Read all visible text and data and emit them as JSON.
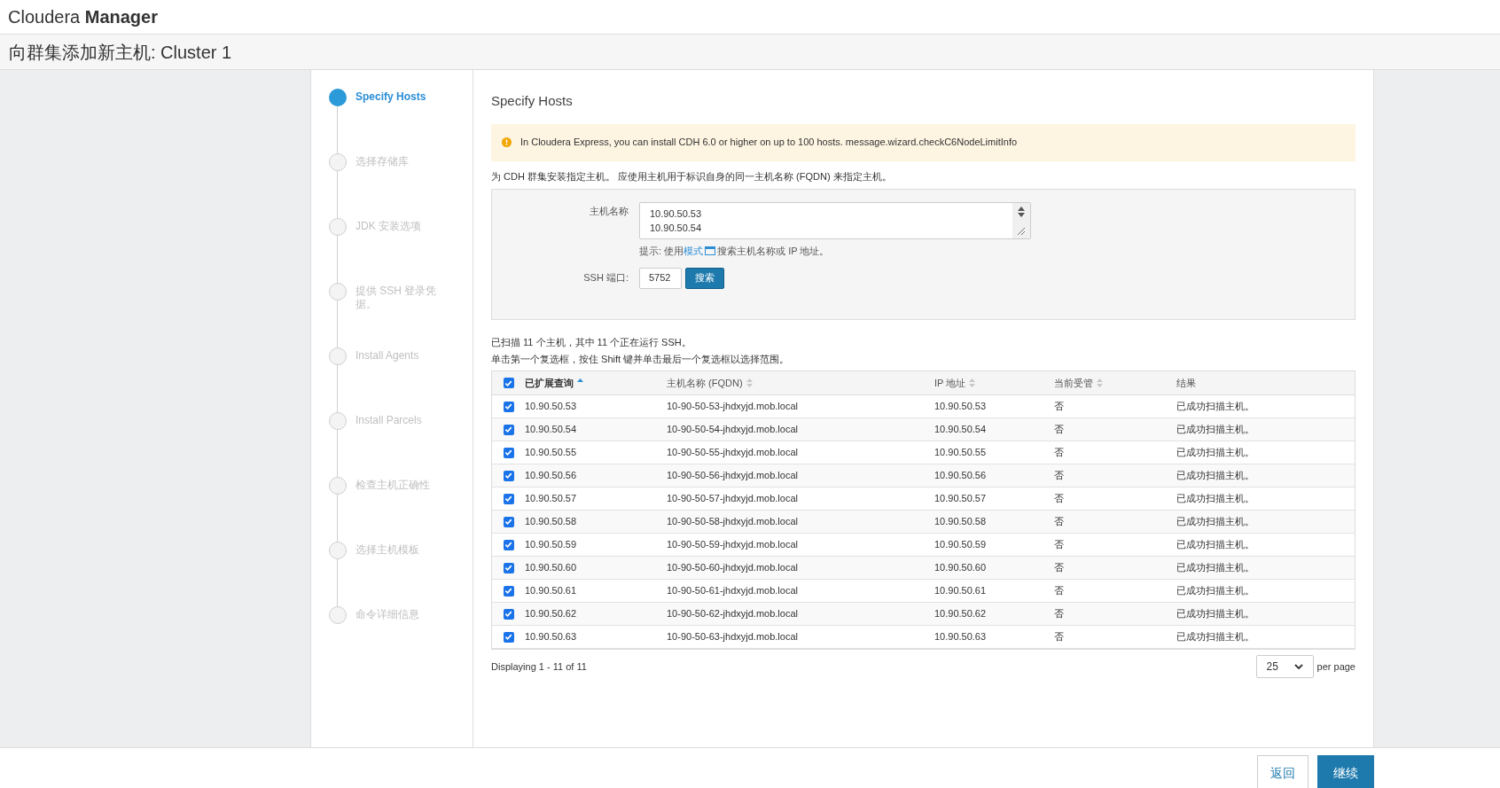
{
  "header": {
    "brand_light": "Cloudera",
    "brand_bold": "Manager"
  },
  "page_title": "向群集添加新主机: Cluster 1",
  "steps": [
    {
      "label": "Specify Hosts",
      "selected": true
    },
    {
      "label": "选择存储库",
      "selected": false
    },
    {
      "label": "JDK 安装选项",
      "selected": false
    },
    {
      "label": "提供 SSH 登录凭据。",
      "selected": false
    },
    {
      "label": "Install Agents",
      "selected": false
    },
    {
      "label": "Install Parcels",
      "selected": false
    },
    {
      "label": "检查主机正确性",
      "selected": false
    },
    {
      "label": "选择主机模板",
      "selected": false
    },
    {
      "label": "命令详细信息",
      "selected": false
    }
  ],
  "section_title": "Specify Hosts",
  "alert": "In Cloudera Express, you can install CDH 6.0 or higher on up to 100 hosts. message.wizard.checkC6NodeLimitInfo",
  "description": "为 CDH 群集安装指定主机。 应使用主机用于标识自身的同一主机名称 (FQDN) 来指定主机。",
  "form": {
    "hostname_label": "主机名称",
    "hostname_lines": [
      "10.90.50.53",
      "10.90.50.54"
    ],
    "hint_before": "提示: 使用",
    "hint_link": "模式",
    "hint_after": "搜索主机名称或 IP 地址。",
    "ssh_label": "SSH 端口:",
    "ssh_value": "5752",
    "search_button": "搜索"
  },
  "scan_summary": "已扫描 11 个主机，其中 11 个正在运行 SSH。",
  "select_hint": "单击第一个复选框，按住 Shift 键并单击最后一个复选框以选择范围。",
  "table": {
    "all_checked": true,
    "columns": [
      {
        "label": "已扩展查询",
        "sorted": true
      },
      {
        "label": "主机名称 (FQDN)",
        "sorted": false
      },
      {
        "label": "IP 地址",
        "sorted": false
      },
      {
        "label": "当前受管",
        "sorted": false
      },
      {
        "label": "结果"
      }
    ],
    "rows": [
      {
        "checked": true,
        "cells": [
          "10.90.50.53",
          "10-90-50-53-jhdxyjd.mob.local",
          "10.90.50.53",
          "否",
          "已成功扫描主机。"
        ]
      },
      {
        "checked": true,
        "cells": [
          "10.90.50.54",
          "10-90-50-54-jhdxyjd.mob.local",
          "10.90.50.54",
          "否",
          "已成功扫描主机。"
        ]
      },
      {
        "checked": true,
        "cells": [
          "10.90.50.55",
          "10-90-50-55-jhdxyjd.mob.local",
          "10.90.50.55",
          "否",
          "已成功扫描主机。"
        ]
      },
      {
        "checked": true,
        "cells": [
          "10.90.50.56",
          "10-90-50-56-jhdxyjd.mob.local",
          "10.90.50.56",
          "否",
          "已成功扫描主机。"
        ]
      },
      {
        "checked": true,
        "cells": [
          "10.90.50.57",
          "10-90-50-57-jhdxyjd.mob.local",
          "10.90.50.57",
          "否",
          "已成功扫描主机。"
        ]
      },
      {
        "checked": true,
        "cells": [
          "10.90.50.58",
          "10-90-50-58-jhdxyjd.mob.local",
          "10.90.50.58",
          "否",
          "已成功扫描主机。"
        ]
      },
      {
        "checked": true,
        "cells": [
          "10.90.50.59",
          "10-90-50-59-jhdxyjd.mob.local",
          "10.90.50.59",
          "否",
          "已成功扫描主机。"
        ]
      },
      {
        "checked": true,
        "cells": [
          "10.90.50.60",
          "10-90-50-60-jhdxyjd.mob.local",
          "10.90.50.60",
          "否",
          "已成功扫描主机。"
        ]
      },
      {
        "checked": true,
        "cells": [
          "10.90.50.61",
          "10-90-50-61-jhdxyjd.mob.local",
          "10.90.50.61",
          "否",
          "已成功扫描主机。"
        ]
      },
      {
        "checked": true,
        "cells": [
          "10.90.50.62",
          "10-90-50-62-jhdxyjd.mob.local",
          "10.90.50.62",
          "否",
          "已成功扫描主机。"
        ]
      },
      {
        "checked": true,
        "cells": [
          "10.90.50.63",
          "10-90-50-63-jhdxyjd.mob.local",
          "10.90.50.63",
          "否",
          "已成功扫描主机。"
        ]
      }
    ]
  },
  "pagination": {
    "summary": "Displaying 1 - 11 of 11",
    "page_size": "25",
    "per_page": "per page"
  },
  "footer": {
    "back": "返回",
    "continue": "继续"
  }
}
